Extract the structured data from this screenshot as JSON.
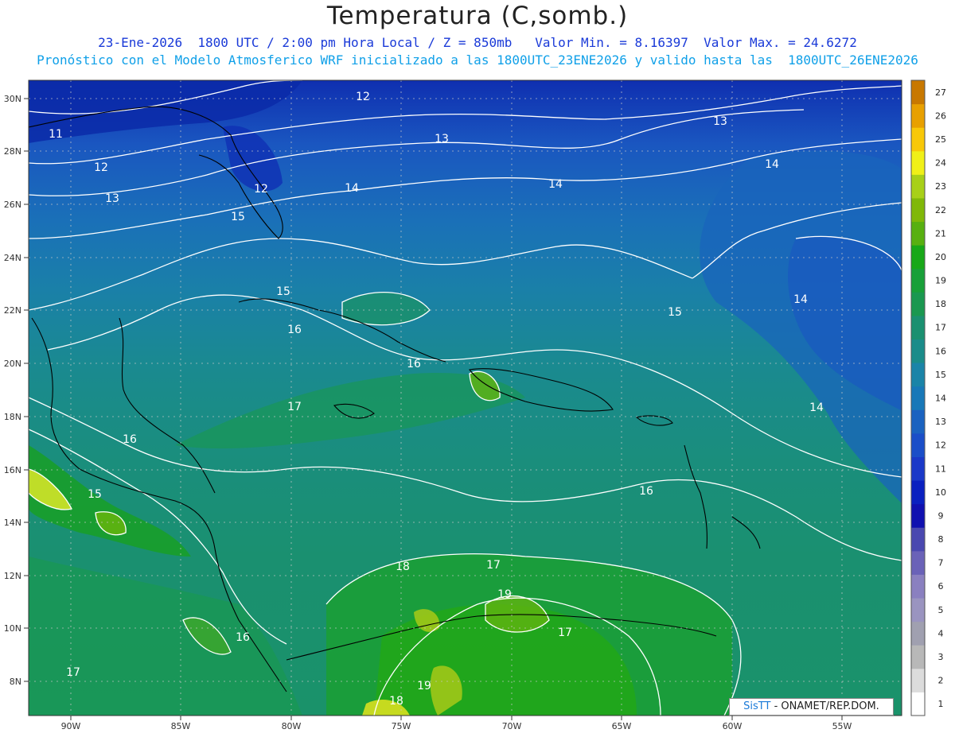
{
  "header": {
    "title": "Temperatura (C,somb.)",
    "line1": "23-Ene-2026  1800 UTC / 2:00 pm Hora Local / Z = 850mb   Valor Min. = 8.16397  Valor Max. = 24.6272",
    "line2": "Pronóstico con el Modelo Atmosferico WRF inicializado a las 1800UTC_23ENE2026 y valido hasta las  1800UTC_26ENE2026"
  },
  "axes": {
    "lat_labels": [
      "30N",
      "28N",
      "26N",
      "24N",
      "22N",
      "20N",
      "18N",
      "16N",
      "14N",
      "12N",
      "10N",
      "8N"
    ],
    "lon_labels": [
      "90W",
      "85W",
      "80W",
      "75W",
      "70W",
      "65W",
      "60W",
      "55W"
    ]
  },
  "colorbar": {
    "labels": [
      "1",
      "2",
      "3",
      "4",
      "5",
      "6",
      "7",
      "8",
      "9",
      "10",
      "11",
      "12",
      "13",
      "14",
      "15",
      "16",
      "17",
      "18",
      "19",
      "20",
      "21",
      "22",
      "23",
      "24",
      "25",
      "26",
      "27"
    ],
    "colors": [
      "#ffffff",
      "#dcdcdc",
      "#b8b8b8",
      "#a0a0b0",
      "#9a94c0",
      "#8a80c0",
      "#6a62b8",
      "#4a48b0",
      "#1010b0",
      "#0a20c0",
      "#1a38c8",
      "#1a4ec8",
      "#1a62c0",
      "#1878b8",
      "#1a84a8",
      "#1a8c8a",
      "#1a9070",
      "#1a9850",
      "#18a038",
      "#18a818",
      "#58b010",
      "#80b808",
      "#a8d018",
      "#f0f018",
      "#f8c808",
      "#e8a000",
      "#c87800"
    ]
  },
  "contour_labels": [
    "11",
    "12",
    "12",
    "12",
    "13",
    "13",
    "13",
    "14",
    "14",
    "14",
    "14",
    "14",
    "15",
    "15",
    "15",
    "15",
    "16",
    "16",
    "16",
    "16",
    "16",
    "17",
    "17",
    "17",
    "17",
    "18",
    "18",
    "19",
    "19"
  ],
  "credit": {
    "sis": "SisTT",
    "org": " - ONAMET/REP.DOM."
  }
}
